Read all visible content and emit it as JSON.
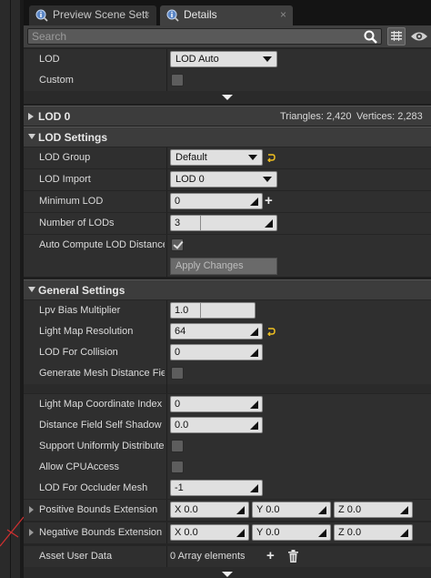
{
  "tabs": [
    {
      "label": "Preview Scene Sett",
      "close": "×"
    },
    {
      "label": "Details",
      "close": "×"
    }
  ],
  "search": {
    "placeholder": "Search"
  },
  "top": {
    "lod_label": "LOD",
    "lod_value": "LOD Auto",
    "custom_label": "Custom",
    "custom_checked": false
  },
  "lod0": {
    "title": "LOD 0",
    "triangles": "Triangles: 2,420",
    "vertices": "Vertices: 2,283"
  },
  "lod_settings": {
    "title": "LOD Settings",
    "lod_group_label": "LOD Group",
    "lod_group_value": "Default",
    "lod_import_label": "LOD Import",
    "lod_import_value": "LOD 0",
    "min_lod_label": "Minimum LOD",
    "min_lod_value": "0",
    "min_lod_add": "+",
    "num_lods_label": "Number of LODs",
    "num_lods_value": "3",
    "auto_compute_label": "Auto Compute LOD Distance",
    "auto_compute_checked": true,
    "apply_label": "Apply Changes"
  },
  "general": {
    "title": "General Settings",
    "lpv_label": "Lpv Bias Multiplier",
    "lpv_value": "1.0",
    "lightmap_res_label": "Light Map Resolution",
    "lightmap_res_value": "64",
    "lod_collision_label": "LOD For Collision",
    "lod_collision_value": "0",
    "gen_mesh_df_label": "Generate Mesh Distance Fiel",
    "lightmap_coord_label": "Light Map Coordinate Index",
    "lightmap_coord_value": "0",
    "df_shadow_label": "Distance Field Self Shadow B",
    "df_shadow_value": "0.0",
    "support_uniform_label": "Support Uniformly Distribute",
    "allow_cpu_label": "Allow CPUAccess",
    "lod_occluder_label": "LOD For Occluder Mesh",
    "lod_occluder_value": "-1",
    "pos_bounds_label": "Positive Bounds Extension",
    "pos_bounds": {
      "x": "X  0.0",
      "y": "Y  0.0",
      "z": "Z  0.0"
    },
    "neg_bounds_label": "Negative Bounds Extension",
    "neg_bounds": {
      "x": "X  0.0",
      "y": "Y  0.0",
      "z": "Z  0.0"
    },
    "asset_user_data_label": "Asset User Data",
    "asset_user_data_value": "0 Array elements",
    "asset_user_data_add": "+"
  },
  "colors": {
    "accent_reset": "#f0c020",
    "search_icon": "#ffffff",
    "eye_icon": "#d0d0d0"
  }
}
